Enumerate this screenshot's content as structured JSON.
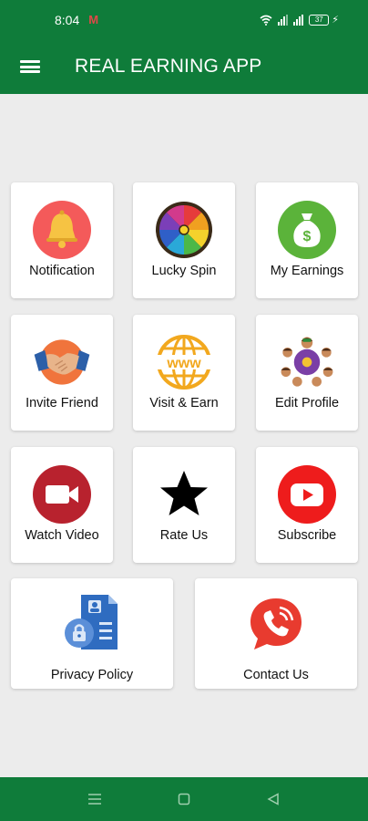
{
  "status_bar": {
    "time": "8:04",
    "mail_icon": "M",
    "battery": "37"
  },
  "app_bar": {
    "title": "REAL EARNING APP",
    "menu_icon": "hamburger-icon"
  },
  "colors": {
    "primary": "#0f7c3a",
    "background": "#ececec"
  },
  "tiles": [
    {
      "label": "Notification",
      "icon": "bell-icon"
    },
    {
      "label": "Lucky Spin",
      "icon": "spin-wheel-icon"
    },
    {
      "label": "My Earnings",
      "icon": "money-bag-icon"
    },
    {
      "label": "Invite Friend",
      "icon": "handshake-icon"
    },
    {
      "label": "Visit & Earn",
      "icon": "www-globe-icon"
    },
    {
      "label": "Edit Profile",
      "icon": "people-network-icon"
    },
    {
      "label": "Watch Video",
      "icon": "video-camera-icon"
    },
    {
      "label": "Rate Us",
      "icon": "star-icon"
    },
    {
      "label": "Subscribe",
      "icon": "youtube-icon"
    },
    {
      "label": "Privacy Policy",
      "icon": "privacy-document-icon"
    },
    {
      "label": "Contact Us",
      "icon": "phone-call-icon"
    }
  ],
  "nav_bar": {
    "icons": [
      "menu-icon",
      "home-square-icon",
      "back-triangle-icon"
    ]
  },
  "icon_text": {
    "money_symbol": "$",
    "www": "www"
  }
}
